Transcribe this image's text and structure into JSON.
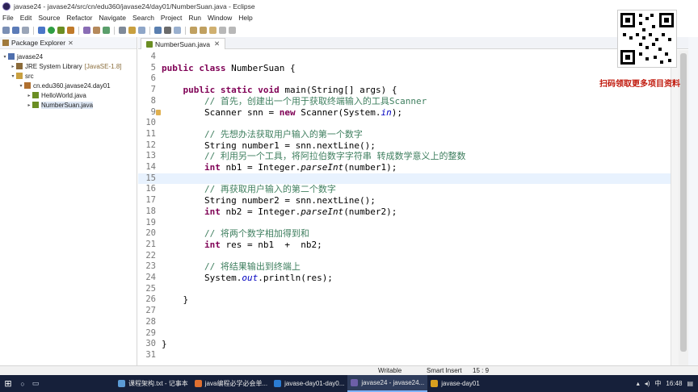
{
  "window": {
    "title": "javase24 - javase24/src/cn/edu360/javase24/day01/NumberSuan.java - Eclipse"
  },
  "menubar": [
    "File",
    "Edit",
    "Source",
    "Refactor",
    "Navigate",
    "Search",
    "Project",
    "Run",
    "Window",
    "Help"
  ],
  "package_explorer": {
    "title": "Package Explorer",
    "close": "✕",
    "tree": [
      {
        "label": "javase24",
        "extra": "",
        "indent": 0,
        "toggle": "▾",
        "icon": "project-icon",
        "color": "#4f6fad",
        "selected": false
      },
      {
        "label": "JRE System Library",
        "extra": "[JavaSE-1.8]",
        "indent": 1,
        "toggle": "▸",
        "icon": "library-icon",
        "color": "#8b6b3a",
        "selected": false
      },
      {
        "label": "src",
        "extra": "",
        "indent": 1,
        "toggle": "▾",
        "icon": "folder-icon",
        "color": "#c9a040",
        "selected": false
      },
      {
        "label": "cn.edu360.javase24.day01",
        "extra": "",
        "indent": 2,
        "toggle": "▾",
        "icon": "package-icon",
        "color": "#b07030",
        "selected": false
      },
      {
        "label": "HelloWorld.java",
        "extra": "",
        "indent": 3,
        "toggle": "▸",
        "icon": "java-file-icon",
        "color": "#6b8e23",
        "selected": false
      },
      {
        "label": "NumberSuan.java",
        "extra": "",
        "indent": 3,
        "toggle": "▸",
        "icon": "java-file-icon",
        "color": "#6b8e23",
        "selected": true
      }
    ]
  },
  "editor": {
    "tab_label": "NumberSuan.java",
    "tab_close": "✕",
    "current_line": "15",
    "lines": [
      {
        "n": "4",
        "html": ""
      },
      {
        "n": "5",
        "html": "<span class=\"kw\">public</span> <span class=\"kw\">class</span> NumberSuan {"
      },
      {
        "n": "6",
        "html": ""
      },
      {
        "n": "7",
        "html": "    <span class=\"kw\">public</span> <span class=\"kw\">static</span> <span class=\"kw\">void</span> main(String[] args) {"
      },
      {
        "n": "8",
        "html": "        <span class=\"cm\">// 首先，创建出一个用于获取终端输入的工具Scanner</span>"
      },
      {
        "n": "9",
        "html": "        Scanner snn = <span class=\"kw\">new</span> Scanner(System.<span class=\"fld\">in</span>);"
      },
      {
        "n": "10",
        "html": ""
      },
      {
        "n": "11",
        "html": "        <span class=\"cm\">// 先想办法获取用户输入的第一个数字</span>"
      },
      {
        "n": "12",
        "html": "        String number1 = snn.nextLine();"
      },
      {
        "n": "13",
        "html": "        <span class=\"cm\">// 利用另一个工具，将阿拉伯数字字符串 转成数学意义上的整数</span>"
      },
      {
        "n": "14",
        "html": "        <span class=\"kw\">int</span> nb1 = Integer.<span class=\"it\">parseInt</span>(number1);"
      },
      {
        "n": "15",
        "html": ""
      },
      {
        "n": "16",
        "html": "        <span class=\"cm\">// 再获取用户输入的第二个数字</span>"
      },
      {
        "n": "17",
        "html": "        String number2 = snn.nextLine();"
      },
      {
        "n": "18",
        "html": "        <span class=\"kw\">int</span> nb2 = Integer.<span class=\"it\">parseInt</span>(number2);"
      },
      {
        "n": "19",
        "html": ""
      },
      {
        "n": "20",
        "html": "        <span class=\"cm\">// 将两个数字相加得到和</span>"
      },
      {
        "n": "21",
        "html": "        <span class=\"kw\">int</span> res = nb1  +  nb2;"
      },
      {
        "n": "22",
        "html": ""
      },
      {
        "n": "23",
        "html": "        <span class=\"cm\">// 将结果输出到终端上</span>"
      },
      {
        "n": "24",
        "html": "        System.<span class=\"fld\">out</span>.println(res);"
      },
      {
        "n": "25",
        "html": ""
      },
      {
        "n": "26",
        "html": "    }"
      },
      {
        "n": "27",
        "html": ""
      },
      {
        "n": "28",
        "html": ""
      },
      {
        "n": "29",
        "html": ""
      },
      {
        "n": "30",
        "html": "}"
      },
      {
        "n": "31",
        "html": ""
      }
    ]
  },
  "status": {
    "writable": "Writable",
    "insert_mode": "Smart Insert",
    "position": "15 : 9"
  },
  "taskbar": {
    "apps": [
      {
        "label": "课程架构.txt - 记事本",
        "icon_color": "#5b9bd5",
        "active": false
      },
      {
        "label": "java编程必学必会单...",
        "icon_color": "#e07030",
        "active": false
      },
      {
        "label": "javase-day01-day0...",
        "icon_color": "#2b7cd3",
        "active": false
      },
      {
        "label": "javase24 - javase24...",
        "icon_color": "#6d5fa8",
        "active": true
      },
      {
        "label": "javase-day01",
        "icon_color": "#d9a020",
        "active": false
      }
    ],
    "clock": "16:48",
    "input_indicator": "中"
  },
  "promo": {
    "text": "扫码领取更多项目资料"
  }
}
